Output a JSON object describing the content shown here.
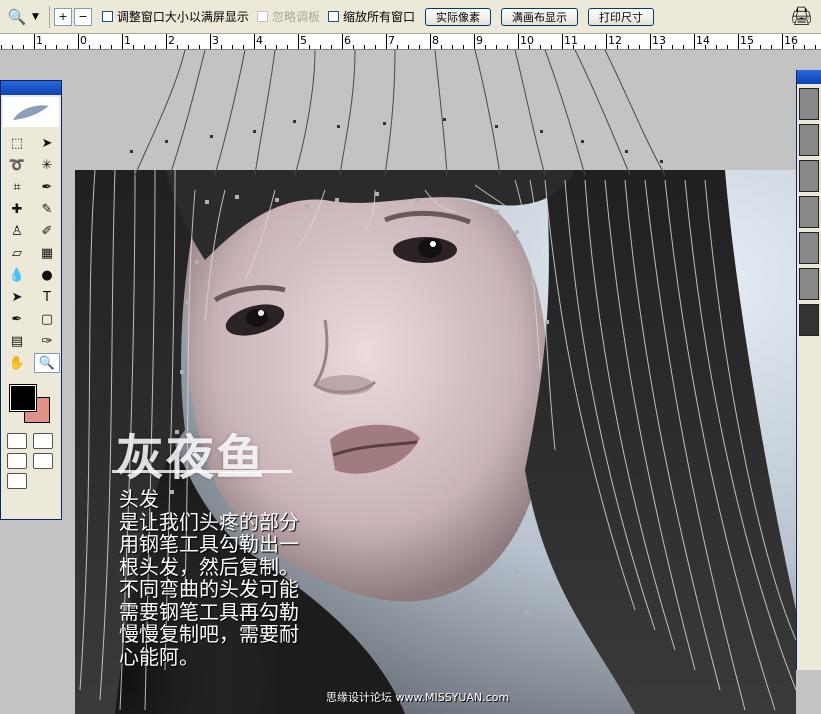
{
  "options_bar": {
    "tool_icon": "zoom-icon",
    "zoom_in_label": "+",
    "zoom_out_label": "−",
    "checkbox_resize_label": "调整窗口大小以满屏显示",
    "checkbox_ignore_palettes_label": "忽略调板",
    "checkbox_zoom_all_label": "缩放所有窗口",
    "btn_actual_pixels": "实际像素",
    "btn_fit_screen": "满画布显示",
    "btn_print_size": "打印尺寸"
  },
  "ruler": {
    "numbers": [
      "1",
      "0",
      "1",
      "2",
      "3",
      "4",
      "5",
      "6",
      "7",
      "8",
      "9",
      "10",
      "11",
      "12",
      "13",
      "14",
      "15",
      "16"
    ]
  },
  "toolbox": {
    "tools": [
      {
        "name": "marquee-tool",
        "glyph": "⬚"
      },
      {
        "name": "move-tool",
        "glyph": "➤"
      },
      {
        "name": "lasso-tool",
        "glyph": "➰"
      },
      {
        "name": "magic-wand-tool",
        "glyph": "✳"
      },
      {
        "name": "crop-tool",
        "glyph": "⌗"
      },
      {
        "name": "slice-tool",
        "glyph": "✒"
      },
      {
        "name": "healing-brush-tool",
        "glyph": "✚"
      },
      {
        "name": "brush-tool",
        "glyph": "✎"
      },
      {
        "name": "clone-stamp-tool",
        "glyph": "♙"
      },
      {
        "name": "history-brush-tool",
        "glyph": "✐"
      },
      {
        "name": "eraser-tool",
        "glyph": "▱"
      },
      {
        "name": "gradient-tool",
        "glyph": "▦"
      },
      {
        "name": "blur-tool",
        "glyph": "💧"
      },
      {
        "name": "dodge-tool",
        "glyph": "●"
      },
      {
        "name": "path-selection-tool",
        "glyph": "➤"
      },
      {
        "name": "type-tool",
        "glyph": "T"
      },
      {
        "name": "pen-tool",
        "glyph": "✒"
      },
      {
        "name": "shape-tool",
        "glyph": "▢"
      },
      {
        "name": "notes-tool",
        "glyph": "▤"
      },
      {
        "name": "eyedropper-tool",
        "glyph": "✑"
      },
      {
        "name": "hand-tool",
        "glyph": "✋"
      },
      {
        "name": "zoom-tool",
        "glyph": "🔍"
      }
    ],
    "foreground_color": "#000000",
    "background_color": "#e1908a"
  },
  "overlay": {
    "logo_text": "灰夜鱼",
    "caption_lines": [
      "头发",
      "是让我们头疼的部分",
      "用钢笔工具勾勒出一",
      "根头发，然后复制。",
      "不同弯曲的头发可能",
      "需要钢笔工具再勾勒",
      "慢慢复制吧，需要耐",
      "心能阿。"
    ],
    "watermark": "思缘设计论坛 www.MISSYUAN.com"
  }
}
